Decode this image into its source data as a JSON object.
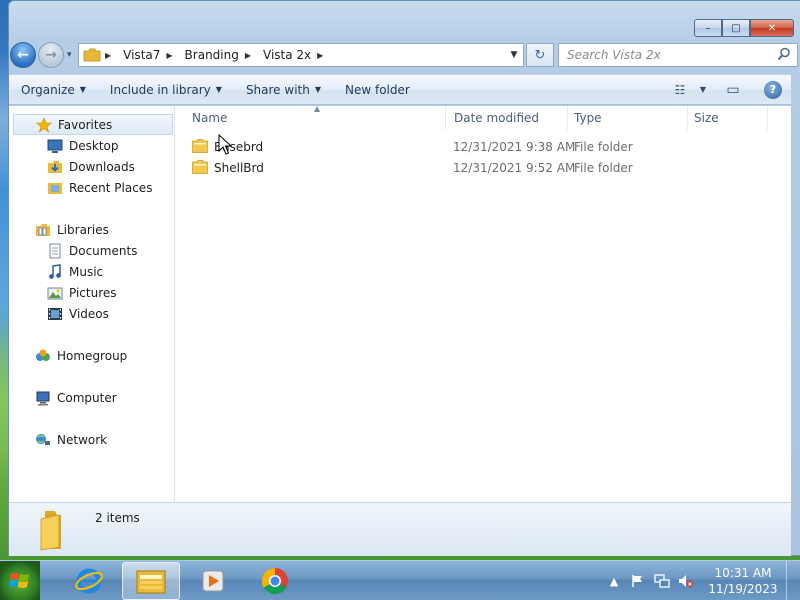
{
  "window": {
    "minimize_label": "–",
    "maximize_label": "□",
    "close_label": "✕"
  },
  "navigation": {
    "back_label": "←",
    "forward_label": "→",
    "recent_label": "▾"
  },
  "address": {
    "breadcrumbs": [
      "Vista7",
      "Branding",
      "Vista 2x"
    ],
    "separator": "▶",
    "dropdown_label": "▼",
    "refresh_label": "↻"
  },
  "search": {
    "placeholder": "Search Vista 2x"
  },
  "toolbar": {
    "organize": "Organize",
    "include_in_library": "Include in library",
    "share_with": "Share with",
    "new_folder": "New folder",
    "caret": "▼",
    "view_label": "☷",
    "view_caret": "▼",
    "preview_label": "▭",
    "help_label": "?"
  },
  "sidebar": {
    "favorites": {
      "label": "Favorites",
      "items": [
        "Desktop",
        "Downloads",
        "Recent Places"
      ]
    },
    "libraries": {
      "label": "Libraries",
      "items": [
        "Documents",
        "Music",
        "Pictures",
        "Videos"
      ]
    },
    "homegroup": "Homegroup",
    "computer": "Computer",
    "network": "Network"
  },
  "columns": {
    "name": "Name",
    "date_modified": "Date modified",
    "type": "Type",
    "size": "Size",
    "sort_indicator": "▲"
  },
  "files": [
    {
      "name": "Basebrd",
      "date": "12/31/2021 9:38 AM",
      "type": "File folder"
    },
    {
      "name": "ShellBrd",
      "date": "12/31/2021 9:52 AM",
      "type": "File folder"
    }
  ],
  "details": {
    "item_count": "2 items"
  },
  "taskbar": {
    "tray_expand": "▲",
    "time": "10:31 AM",
    "date": "11/19/2023"
  },
  "colors": {
    "accent": "#2a6fc4",
    "folder": "#f2c94c"
  }
}
